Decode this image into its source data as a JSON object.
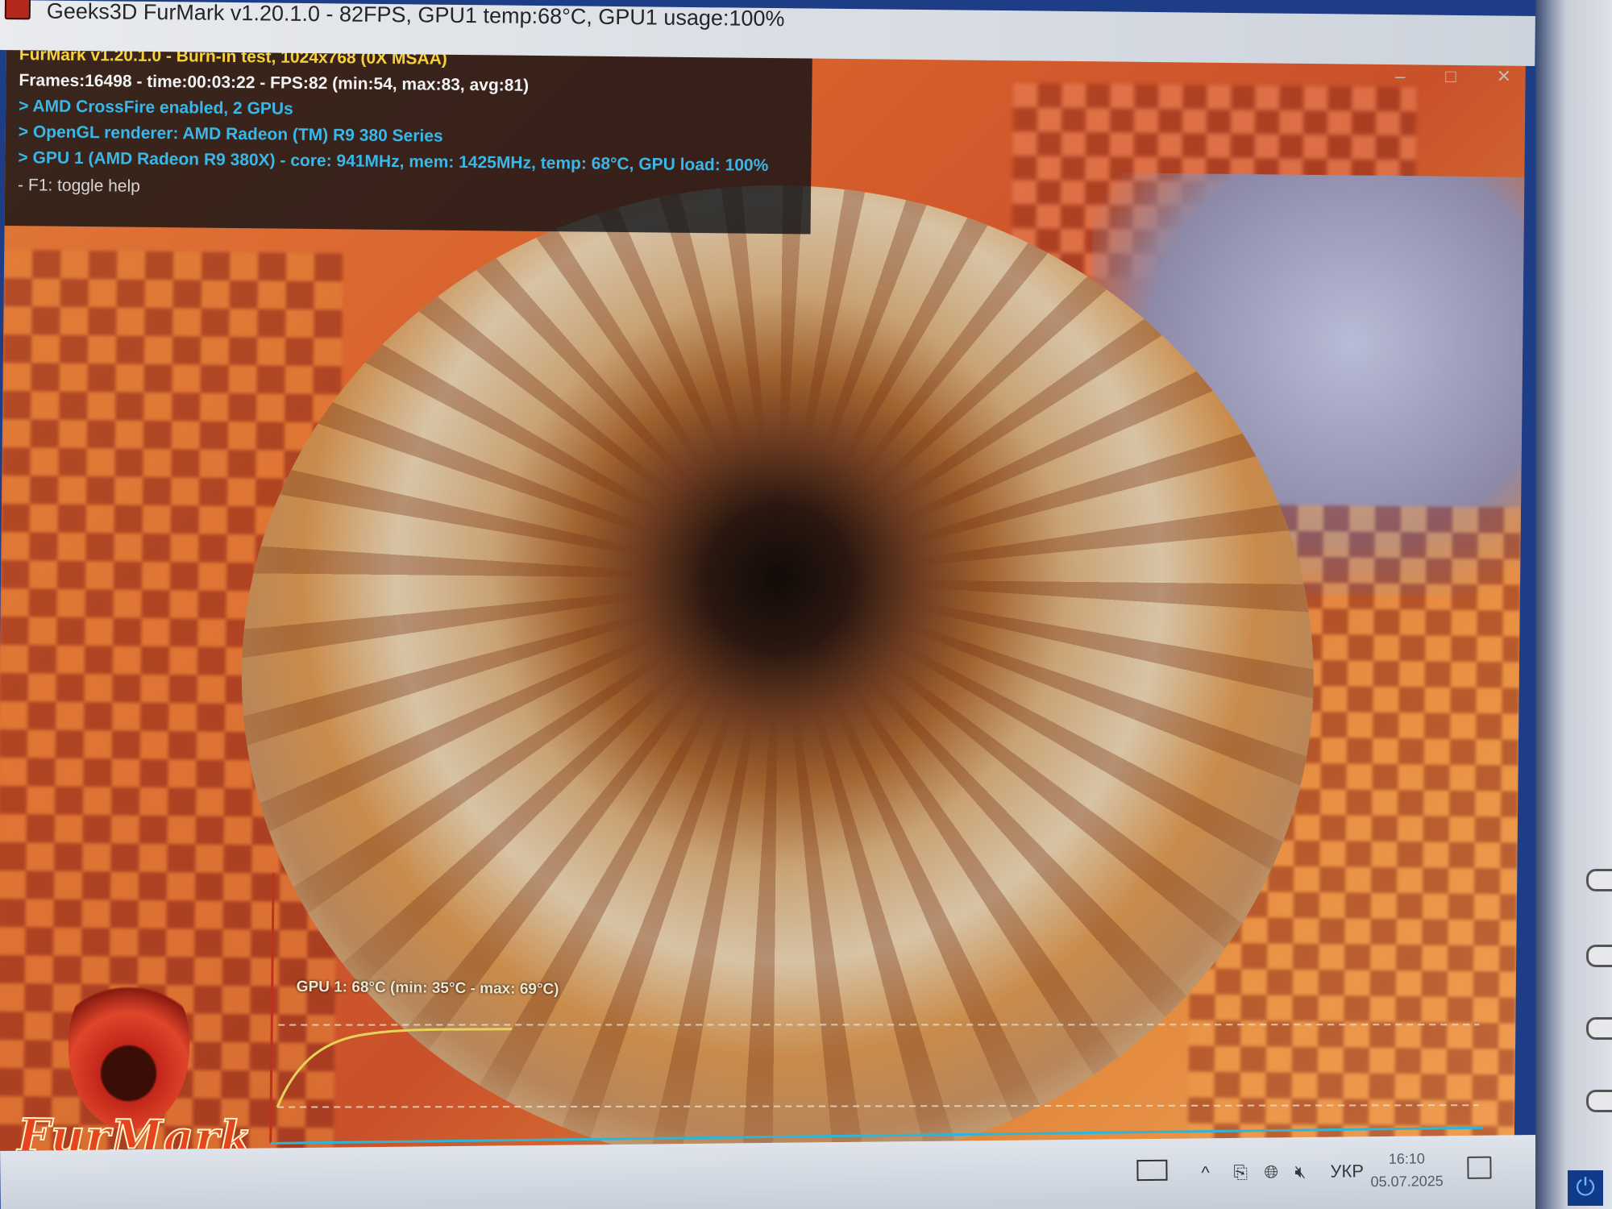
{
  "window": {
    "title": "Geeks3D FurMark v1.20.1.0 - 82FPS, GPU1 temp:68°C, GPU1 usage:100%",
    "controls": [
      "–",
      "□",
      "✕"
    ]
  },
  "info_overlay": {
    "lines": [
      {
        "text": "FurMark v1.20.1.0 - Burn-in test, 1024x768 (0X MSAA)",
        "color": "#f5d23c"
      },
      {
        "text": "Frames:16498 - time:00:03:22 - FPS:82 (min:54, max:83, avg:81)",
        "color": "#f3f3f3"
      },
      {
        "text": "> AMD CrossFire enabled, 2 GPUs",
        "color": "#39b7e8"
      },
      {
        "text": "> OpenGL renderer: AMD Radeon (TM) R9 380 Series",
        "color": "#39b7e8"
      },
      {
        "text": "> GPU 1 (AMD Radeon R9 380X) - core: 941MHz, mem: 1425MHz, temp: 68°C, GPU load: 100%",
        "color": "#39b7e8"
      },
      {
        "text": "- F1: toggle help",
        "color": "#d6d6d6"
      }
    ]
  },
  "temp_graph": {
    "label": "GPU 1: 68°C (min: 35°C - max: 69°C)",
    "current_temp_c": 68,
    "min_temp_c": 35,
    "max_temp_c": 69,
    "line_color": "#e8d35a",
    "axis_color": "#c0301f",
    "baseline_color": "#2fb6d6"
  },
  "logo": {
    "text": "FurMark"
  },
  "taskbar": {
    "language": "УКР",
    "time": "16:10",
    "date": "05.07.2025",
    "icons": [
      "taskview-icon",
      "chevron-up-icon",
      "usb-icon",
      "network-icon",
      "volume-muted-icon",
      "notification-icon"
    ]
  },
  "colors": {
    "info_bg": "#0a0e14",
    "accent": "#39b7e8",
    "title_highlight": "#f5d23c"
  }
}
